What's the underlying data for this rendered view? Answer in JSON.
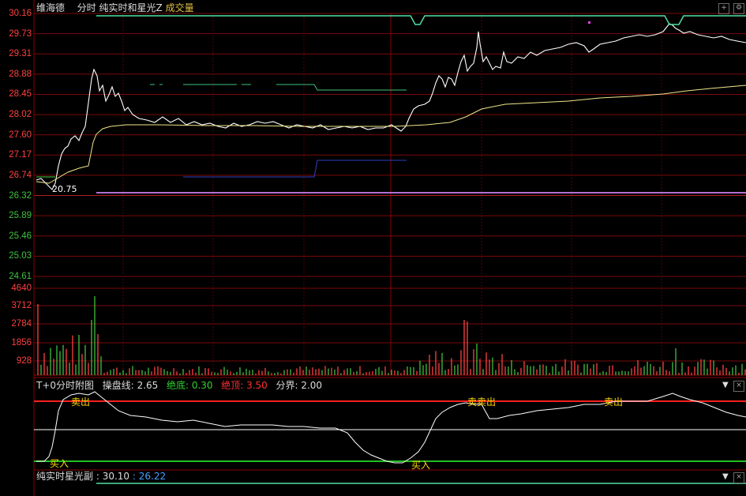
{
  "header": {
    "stock_name": "维海德",
    "mode": "分时",
    "indicator": "纯实时和星光Z",
    "volume_label": "成交量",
    "colors": {
      "stock_name": "#dcdcdc",
      "indicator": "#dcdcdc",
      "volume_label": "#e0c040"
    }
  },
  "toolbar": {
    "add_icon": "plus-circle-icon",
    "settings_icon": "settings-icon"
  },
  "price_chart": {
    "price_levels": [
      "30.16",
      "29.73",
      "29.31",
      "28.88",
      "28.45",
      "28.02",
      "27.60",
      "27.17",
      "26.74",
      "26.32",
      "25.89",
      "25.46",
      "25.03",
      "24.61"
    ],
    "ylim": [
      24.61,
      30.16
    ],
    "low_label": "20.75",
    "colors": {
      "price_line": "#ffffff",
      "avg_line": "#f0e68c",
      "grid": "#8b0000",
      "axis_up": "#ff4040",
      "axis_down": "#40c040",
      "open_line": "#b070d0"
    }
  },
  "volume_chart": {
    "levels": [
      "4640",
      "3712",
      "2784",
      "1856",
      "928"
    ]
  },
  "t0_panel": {
    "title": "T+0分时附图",
    "line_label": "操盘线:",
    "line_value": "2.65",
    "bottom_label": "绝底:",
    "bottom_value": "0.30",
    "top_label": "绝顶:",
    "top_value": "3.50",
    "boundary_label": "分界:",
    "boundary_value": "2.00",
    "signals": [
      {
        "text": "卖出",
        "type": "sell"
      },
      {
        "text": "买入",
        "type": "buy"
      },
      {
        "text": "买入",
        "type": "buy"
      },
      {
        "text": "卖卖出",
        "type": "sell"
      },
      {
        "text": "卖出",
        "type": "sell"
      }
    ],
    "colors": {
      "sell": "#ffd700",
      "buy": "#ffd700",
      "top_line": "#ff2020",
      "bottom_line": "#20c020",
      "mid_line": "#ffffff"
    }
  },
  "sub_panel": {
    "title": "纯实时星光副",
    "value1": ": 30.10",
    "value2": ": 26.22",
    "colors": {
      "title": "#dcdcdc",
      "value1": "#dcdcdc",
      "value2": "#40a0ff",
      "line": "#40e0a0"
    }
  }
}
